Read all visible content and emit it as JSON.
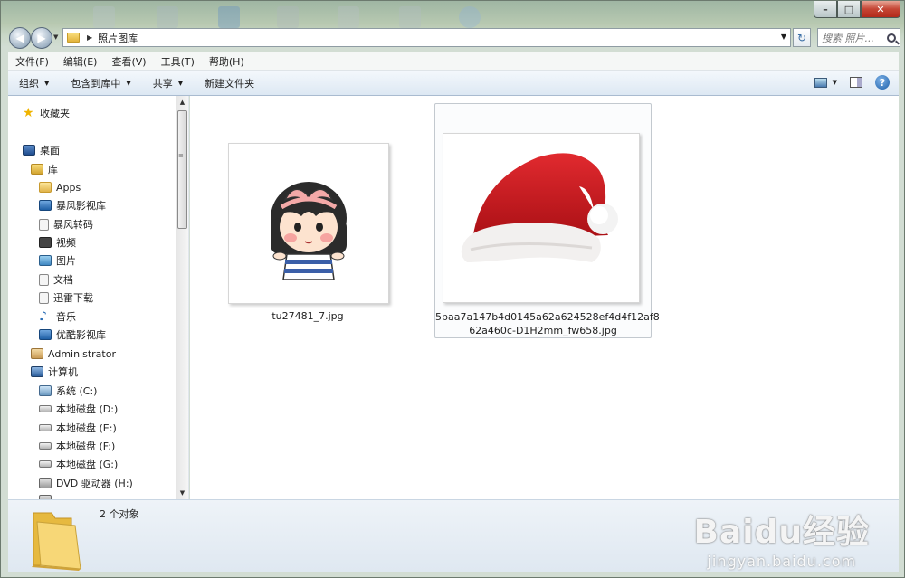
{
  "window": {
    "controls": {
      "minimize": "–",
      "maximize": "□",
      "close": "✕"
    }
  },
  "address": {
    "path": "照片图库",
    "search_placeholder": "搜索 照片..."
  },
  "menubar": [
    "文件(F)",
    "编辑(E)",
    "查看(V)",
    "工具(T)",
    "帮助(H)"
  ],
  "commandbar": [
    "组织",
    "包含到库中",
    "共享",
    "新建文件夹"
  ],
  "navpane": {
    "items": [
      {
        "label": "收藏夹",
        "icon": "star-icon"
      },
      {
        "label": "桌面",
        "icon": "desktop-icon"
      },
      {
        "label": "库",
        "icon": "library-icon"
      },
      {
        "label": "Apps",
        "icon": "folder-icon"
      },
      {
        "label": "暴风影视库",
        "icon": "media-library-icon"
      },
      {
        "label": "暴风转码",
        "icon": "document-icon"
      },
      {
        "label": "视频",
        "icon": "video-icon"
      },
      {
        "label": "图片",
        "icon": "pictures-icon"
      },
      {
        "label": "文档",
        "icon": "document-icon"
      },
      {
        "label": "迅雷下载",
        "icon": "document-icon"
      },
      {
        "label": "音乐",
        "icon": "music-icon"
      },
      {
        "label": "优酷影视库",
        "icon": "media-library-icon"
      },
      {
        "label": "Administrator",
        "icon": "user-icon"
      },
      {
        "label": "计算机",
        "icon": "computer-icon"
      },
      {
        "label": "系统 (C:)",
        "icon": "system-drive-icon"
      },
      {
        "label": "本地磁盘 (D:)",
        "icon": "drive-icon"
      },
      {
        "label": "本地磁盘 (E:)",
        "icon": "drive-icon"
      },
      {
        "label": "本地磁盘 (F:)",
        "icon": "drive-icon"
      },
      {
        "label": "本地磁盘 (G:)",
        "icon": "drive-icon"
      },
      {
        "label": "DVD 驱动器 (H:)",
        "icon": "dvd-drive-icon"
      }
    ]
  },
  "files": [
    {
      "name": "tu27481_7.jpg",
      "selected": false
    },
    {
      "name_line1": "5baa7a147b4d0145a62a624528ef4d4f12af8",
      "name_line2": "62a460c-D1H2mm_fw658.jpg",
      "selected": true
    }
  ],
  "details": {
    "count": "2 个对象"
  },
  "watermark": {
    "logo": "Baidu经验",
    "url": "jingyan.baidu.com"
  },
  "colors": {
    "accent": "#3a6ea5",
    "hat_red": "#c4161c",
    "titlebar": "#b8c9b1"
  }
}
